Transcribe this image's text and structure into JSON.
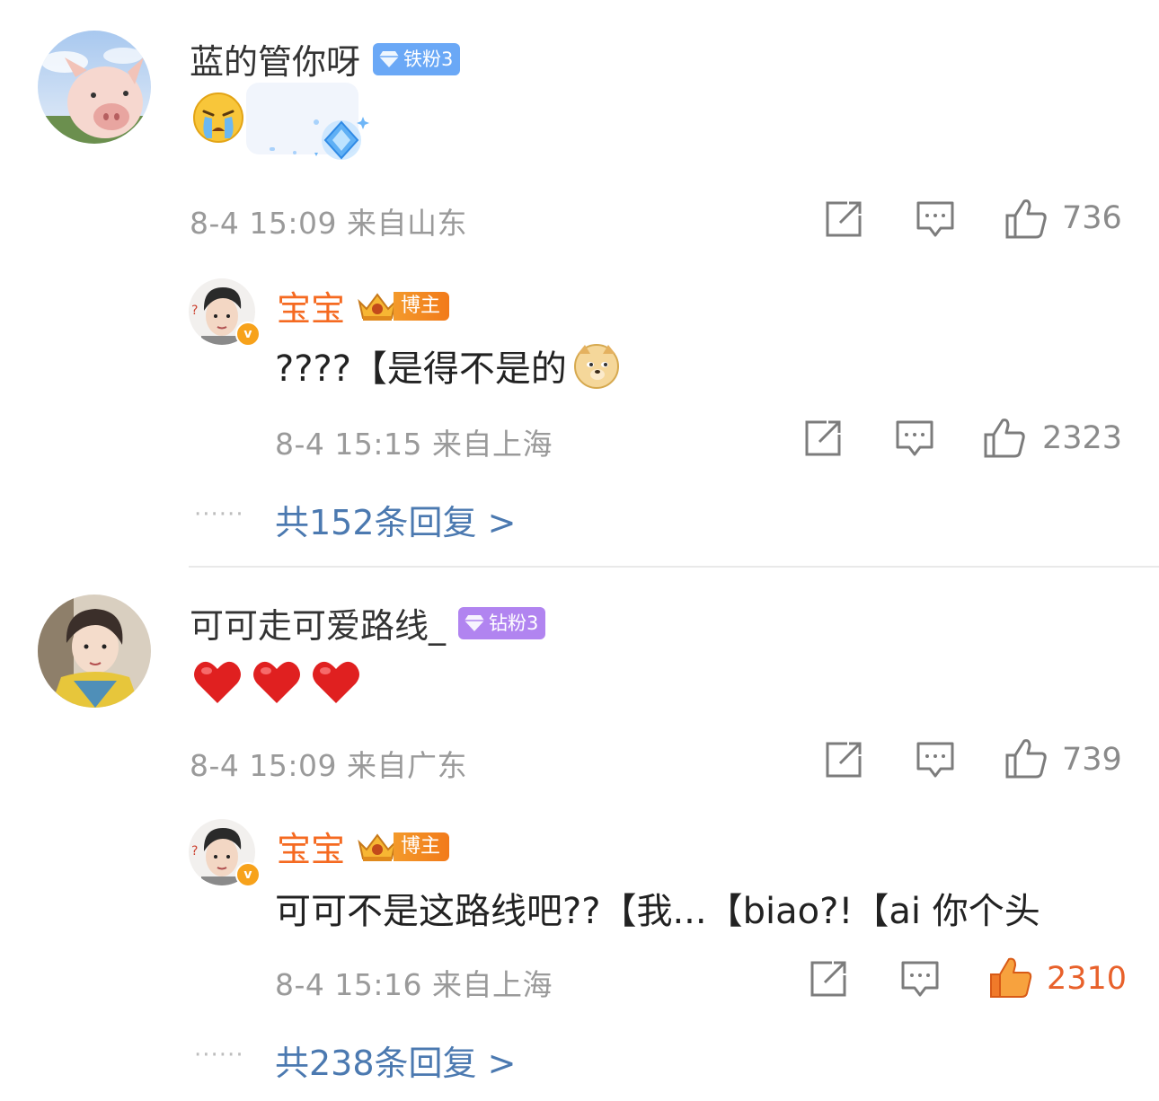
{
  "comments": [
    {
      "username": "蓝的管你呀",
      "fan_badge": "铁粉3",
      "meta": "8-4 15:09  来自山东",
      "likes": "736",
      "reply": {
        "username": "宝宝",
        "badge": "博主",
        "text": "????【是得不是的",
        "meta": "8-4 15:15  来自上海",
        "likes": "2323"
      },
      "more_replies": "共152条回复 >"
    },
    {
      "username": "可可走可爱路线_",
      "fan_badge": "钻粉3",
      "meta": "8-4 15:09  来自广东",
      "likes": "739",
      "reply": {
        "username": "宝宝",
        "badge": "博主",
        "text": "可可不是这路线吧??【我...【biao?!【ai 你个头",
        "meta": "8-4 15:16  来自上海",
        "likes": "2310",
        "liked": true
      },
      "more_replies": "共238条回复 >"
    }
  ],
  "dots": "······",
  "colors": {
    "link": "#4b79b0",
    "blogger": "#f56a21",
    "liked": "#e8612b",
    "meta": "#9a9a9a"
  },
  "icons": [
    "repost-icon",
    "comment-icon",
    "like-icon",
    "crying-emoji",
    "doge-emoji",
    "heart-emoji",
    "diamond-sticker",
    "verified-v-icon",
    "crown-icon"
  ]
}
